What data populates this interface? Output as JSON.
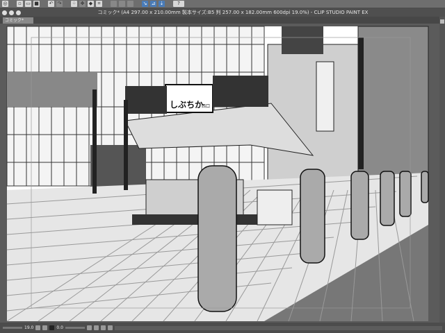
{
  "toolbar": {
    "icons": [
      "app-logo-icon",
      "new-icon",
      "open-icon",
      "save-icon",
      "undo-icon",
      "redo-icon",
      "transform-icon",
      "move-icon",
      "fill-icon",
      "crop-icon",
      "clear-icon",
      "snap-ruler-icon",
      "snap-special-ruler-icon",
      "snap-grid-icon",
      "help-icon"
    ]
  },
  "window": {
    "title": "コミック* (A4 297.00 x 210.00mm 製本サイズ:B5 判 257.00 x 182.00mm 600dpi 19.0%)  - CLIP STUDIO PAINT EX",
    "tab": "コミック*"
  },
  "illustration": {
    "sign_main": "しぶちか",
    "sign_sub": "西口"
  },
  "status": {
    "zoom": "19.0",
    "rotation": "0.0"
  },
  "colors": {
    "accent": "#4a7cb8"
  }
}
